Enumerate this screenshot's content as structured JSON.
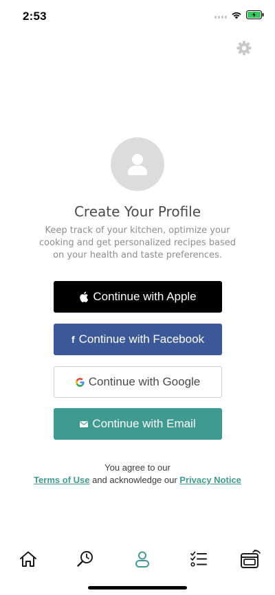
{
  "status_bar": {
    "time": "2:53"
  },
  "profile": {
    "title": "Create Your Profile",
    "subtitle": "Keep track of your kitchen, optimize your cooking and get personalized recipes based on your health and taste preferences."
  },
  "auth": {
    "apple_label": "Continue with Apple",
    "facebook_label": "Continue with Facebook",
    "google_label": "Continue with Google",
    "email_label": "Continue with Email"
  },
  "legal": {
    "line1": "You agree to our",
    "terms_label": "Terms of Use",
    "middle": " and acknowledge our ",
    "privacy_label": "Privacy Notice"
  },
  "colors": {
    "accent": "#3f9b8f",
    "facebook": "#3b5998",
    "apple": "#000000",
    "inactive_icon": "#1a1a1a"
  },
  "tabbar": {
    "icons": [
      "home-icon",
      "search-icon",
      "profile-icon",
      "checklist-icon",
      "oven-icon"
    ],
    "active": "profile-icon"
  }
}
